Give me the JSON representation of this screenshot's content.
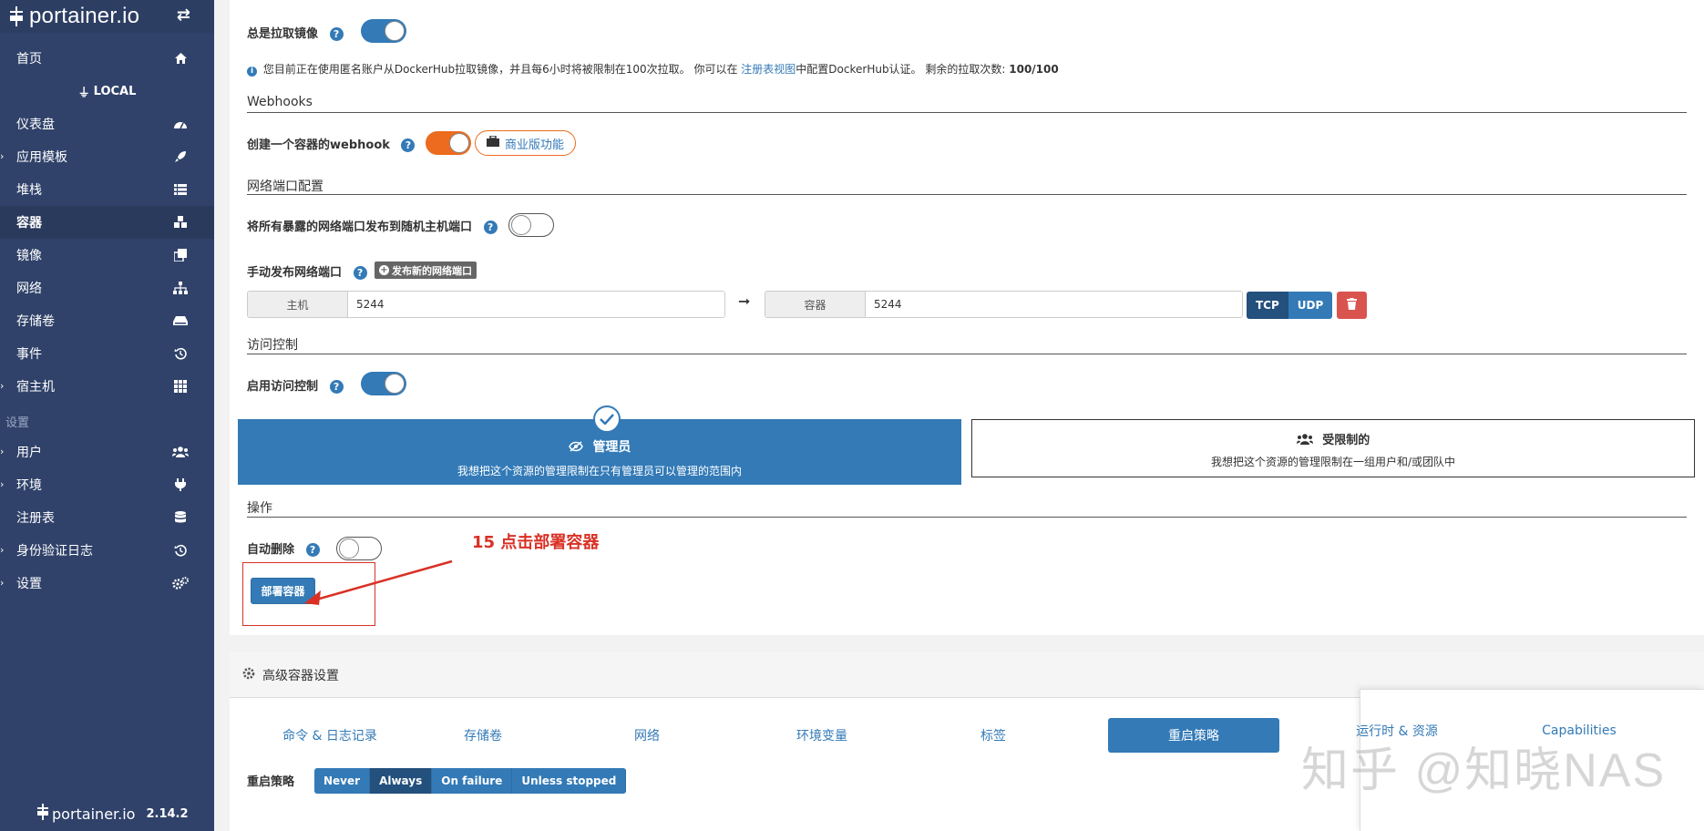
{
  "sidebar": {
    "brand": "portainer.io",
    "items": [
      {
        "label": "首页",
        "icon": "home-icon"
      },
      {
        "label": "仪表盘",
        "icon": "dashboard-icon"
      },
      {
        "label": "应用模板",
        "icon": "rocket-icon"
      },
      {
        "label": "堆栈",
        "icon": "th-list-icon"
      },
      {
        "label": "容器",
        "icon": "cubes-icon"
      },
      {
        "label": "镜像",
        "icon": "clone-icon"
      },
      {
        "label": "网络",
        "icon": "sitemap-icon"
      },
      {
        "label": "存储卷",
        "icon": "hdd-icon"
      },
      {
        "label": "事件",
        "icon": "history-icon"
      },
      {
        "label": "宿主机",
        "icon": "th-icon"
      },
      {
        "label": "用户",
        "icon": "users-icon"
      },
      {
        "label": "环境",
        "icon": "plug-icon"
      },
      {
        "label": "注册表",
        "icon": "database-icon"
      },
      {
        "label": "身份验证日志",
        "icon": "history-icon"
      },
      {
        "label": "设置",
        "icon": "cogs-icon"
      }
    ],
    "env_header": "LOCAL",
    "section_settings": "设置",
    "footer_brand": "portainer.io",
    "version": "2.14.2"
  },
  "form": {
    "always_pull_label": "总是拉取镜像",
    "pull_note_prefix": "您目前正在使用匿名账户从DockerHub拉取镜像，并且每6小时将被限制在100次拉取。 你可以在",
    "pull_note_link": "注册表视图",
    "pull_note_suffix": "中配置DockerHub认证。 剩余的拉取次数:",
    "pull_note_count": "100/100",
    "webhooks_title": "Webhooks",
    "webhook_label": "创建一个容器的webhook",
    "business_button": "商业版功能",
    "network_ports_title": "网络端口配置",
    "publish_all_label": "将所有暴露的网络端口发布到随机主机端口",
    "manual_publish_label": "手动发布网络端口",
    "publish_new_button": "发布新的网络端口",
    "host_addon": "主机",
    "host_port": "5244",
    "container_addon": "容器",
    "container_port": "5244",
    "proto_tcp": "TCP",
    "proto_udp": "UDP",
    "access_control_title": "访问控制",
    "enable_access_label": "启用访问控制",
    "admin_title": "管理员",
    "admin_desc": "我想把这个资源的管理限制在只有管理员可以管理的范围内",
    "restricted_title": "受限制的",
    "restricted_desc": "我想把这个资源的管理限制在一组用户和/或团队中",
    "actions_title": "操作",
    "auto_remove_label": "自动删除",
    "deploy_button": "部署容器",
    "annotation": "15 点击部署容器"
  },
  "advanced": {
    "title": "高级容器设置",
    "tabs": [
      "命令 & 日志记录",
      "存储卷",
      "网络",
      "环境变量",
      "标签",
      "重启策略",
      "运行时 & 资源",
      "Capabilities"
    ],
    "active_tab": "重启策略",
    "restart_label": "重启策略",
    "restart_options": [
      "Never",
      "Always",
      "On failure",
      "Unless stopped"
    ],
    "restart_selected": "Always"
  },
  "watermark": "知乎 @知晓NAS",
  "colors": {
    "sidebar": "#30426a",
    "primary": "#337ab7",
    "primary_dark": "#23507c",
    "orange": "#ec6b1e",
    "danger": "#d9534f",
    "annotation": "#d93025"
  }
}
